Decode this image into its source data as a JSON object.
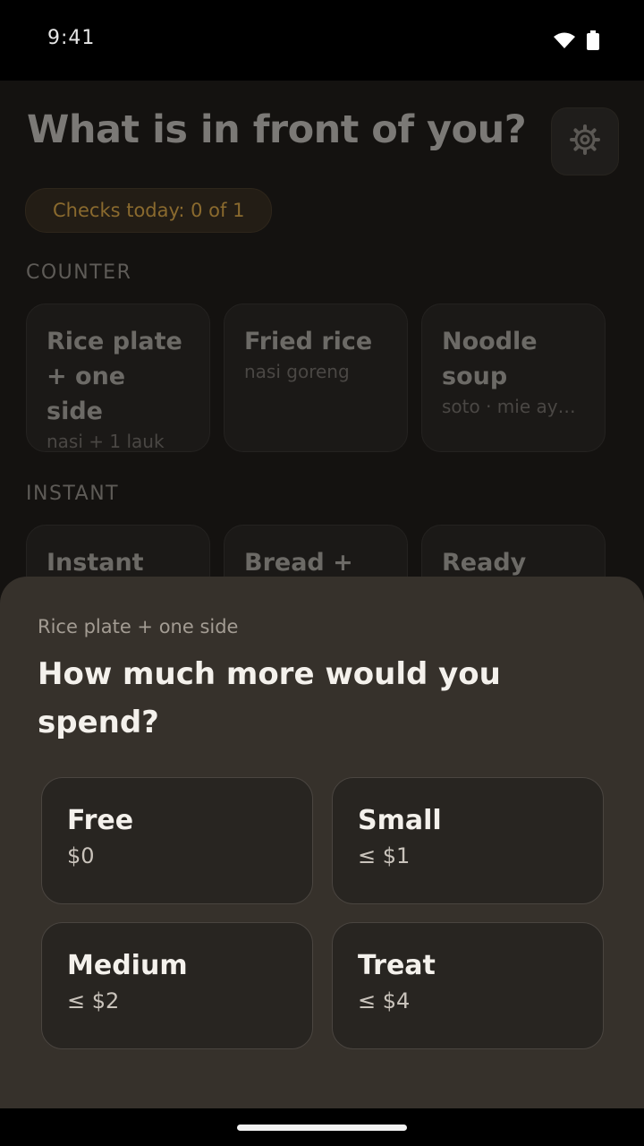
{
  "status_bar": {
    "time": "9:41",
    "icons": [
      "wifi-icon",
      "battery-icon"
    ]
  },
  "header": {
    "title": "What is in front of you?",
    "settings_icon": "gear-icon"
  },
  "checks": {
    "label": "Checks today: 0 of 1"
  },
  "sections": {
    "counter": {
      "label": "COUNTER",
      "items": [
        {
          "title": "Rice plate + one side",
          "subtitle": "nasi + 1 lauk"
        },
        {
          "title": "Fried rice",
          "subtitle": "nasi goreng"
        },
        {
          "title": "Noodle soup",
          "subtitle": "soto · mie aya..."
        }
      ]
    },
    "instant": {
      "label": "INSTANT",
      "items": [
        {
          "title": "Instant"
        },
        {
          "title": "Bread +"
        },
        {
          "title": "Ready"
        }
      ]
    }
  },
  "sheet": {
    "context": "Rice plate + one side",
    "title": "How much more would you spend?",
    "options": [
      {
        "name": "Free",
        "price": "$0"
      },
      {
        "name": "Small",
        "price": "≤ $1"
      },
      {
        "name": "Medium",
        "price": "≤ $2"
      },
      {
        "name": "Treat",
        "price": "≤ $4"
      }
    ]
  },
  "colors": {
    "sheet_bg": "#36312b",
    "option_bg": "#282521",
    "accent_amber": "#8a6a2e"
  }
}
